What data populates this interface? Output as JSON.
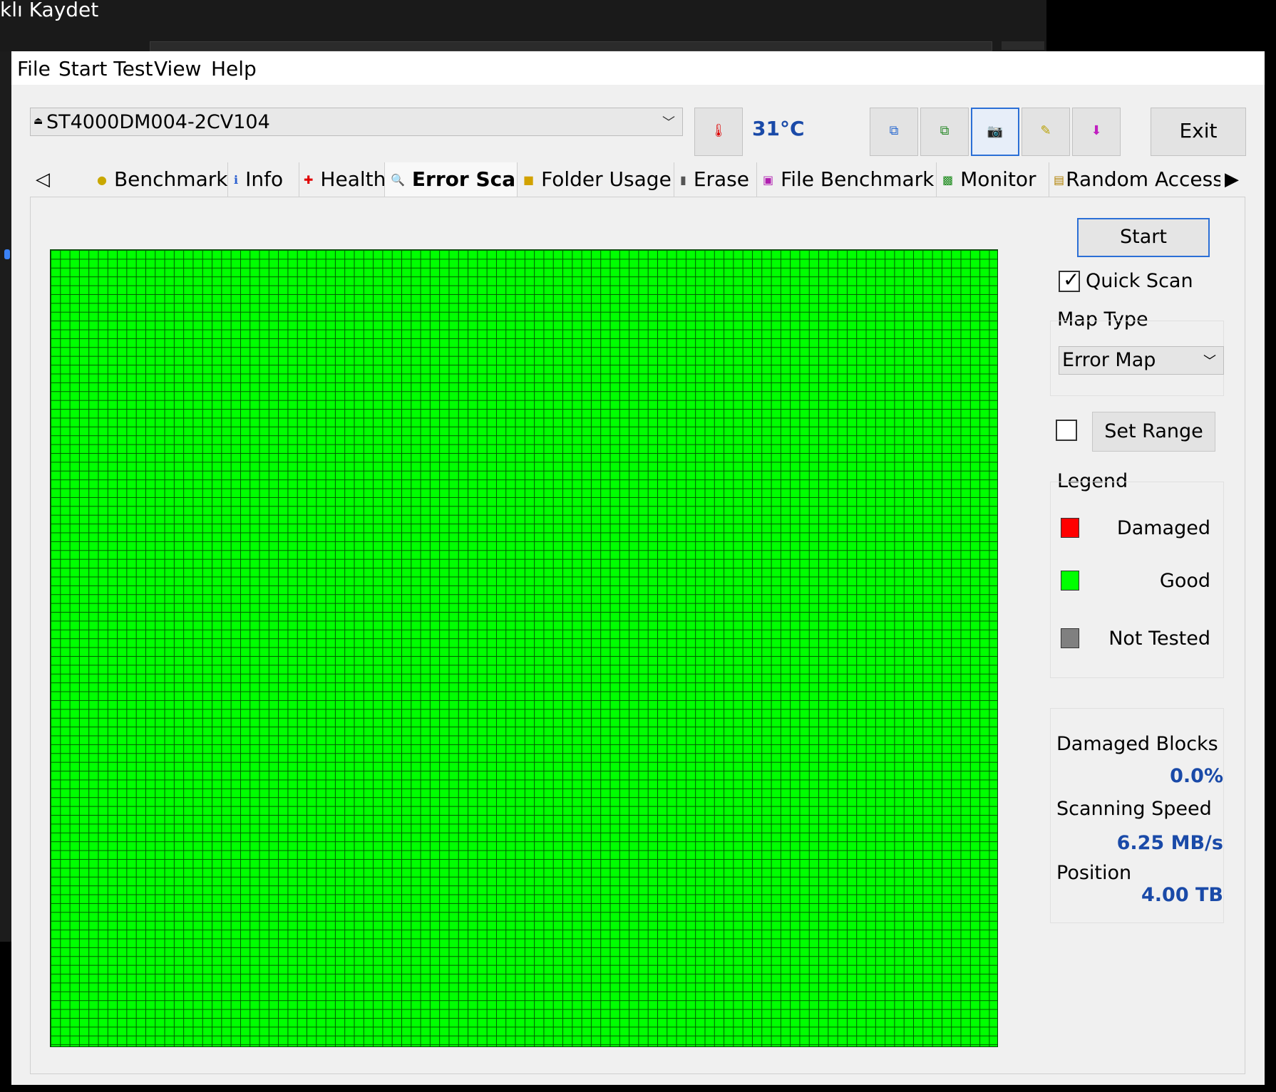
{
  "background": {
    "title_fragment": "klı Kaydet"
  },
  "menu": [
    "File",
    "Start Test",
    "View",
    "Help"
  ],
  "drive": {
    "selected": "ST4000DM004-2CV104"
  },
  "temperature": "31°C",
  "toolbar": {
    "exit_label": "Exit"
  },
  "tabs": [
    "Benchmark",
    "Info",
    "Health",
    "Error Scan",
    "Folder Usage",
    "Erase",
    "File Benchmark",
    "Monitor",
    "Random Access"
  ],
  "active_tab": "Error Scan",
  "scan": {
    "start_label": "Start",
    "quick_scan_label": "Quick Scan",
    "quick_scan_checked": true,
    "map_type_label": "Map Type",
    "map_type_value": "Error Map",
    "set_range_checked": false,
    "set_range_label": "Set Range",
    "legend_label": "Legend",
    "legend": [
      {
        "label": "Damaged",
        "color": "#ff0000"
      },
      {
        "label": "Good",
        "color": "#00ff00"
      },
      {
        "label": "Not Tested",
        "color": "#808080"
      }
    ],
    "damaged_blocks_label": "Damaged Blocks",
    "damaged_blocks_value": "0.0%",
    "scanning_speed_label": "Scanning Speed",
    "scanning_speed_value": "6.25 MB/s",
    "position_label": "Position",
    "position_value": "4.00 TB",
    "map_color": "#00ff00",
    "map_grid_color": "#005a00"
  }
}
